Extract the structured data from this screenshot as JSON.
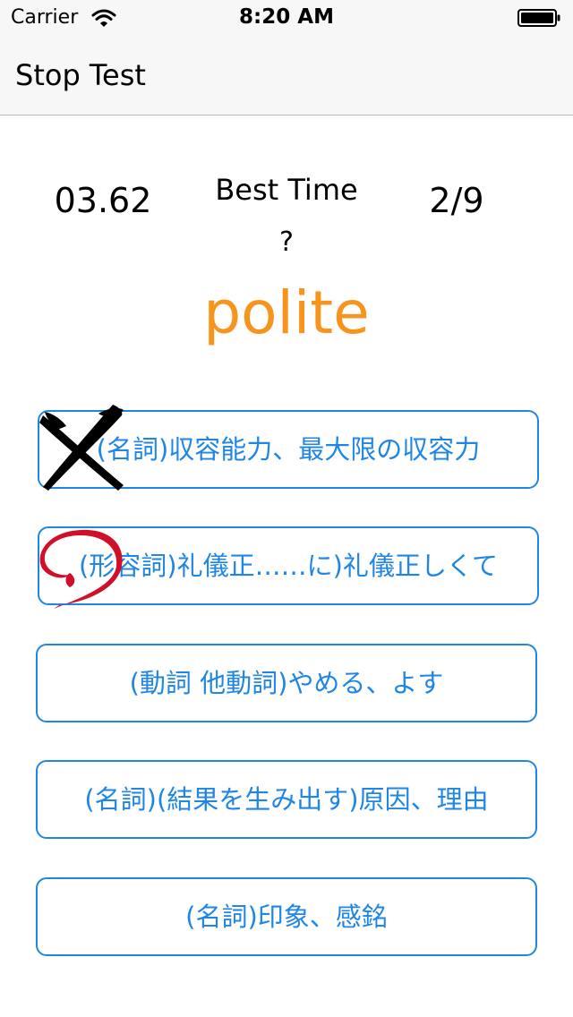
{
  "status_bar": {
    "carrier": "Carrier",
    "time": "8:20 AM"
  },
  "nav": {
    "title": "Stop Test"
  },
  "stats": {
    "timer": "03.62",
    "best_time_label": "Best Time",
    "best_time_value": "?",
    "progress": "2/9"
  },
  "question": {
    "word": "polite",
    "word_color": "#f7941d"
  },
  "answers": [
    {
      "label": "(名詞)収容能力、最大限の収容力",
      "mark": "cross-mark"
    },
    {
      "label": "(形容詞)礼儀正……に)礼儀正しくて",
      "mark": "circle-mark"
    },
    {
      "label": "(動詞 他動詞)やめる、よす"
    },
    {
      "label": "(名詞)(結果を生み出す)原因、理由"
    },
    {
      "label": "(名詞)印象、感銘"
    }
  ],
  "colors": {
    "accent": "#1f86e5",
    "wrong_mark": "#000000",
    "correct_mark": "#d0102a"
  }
}
